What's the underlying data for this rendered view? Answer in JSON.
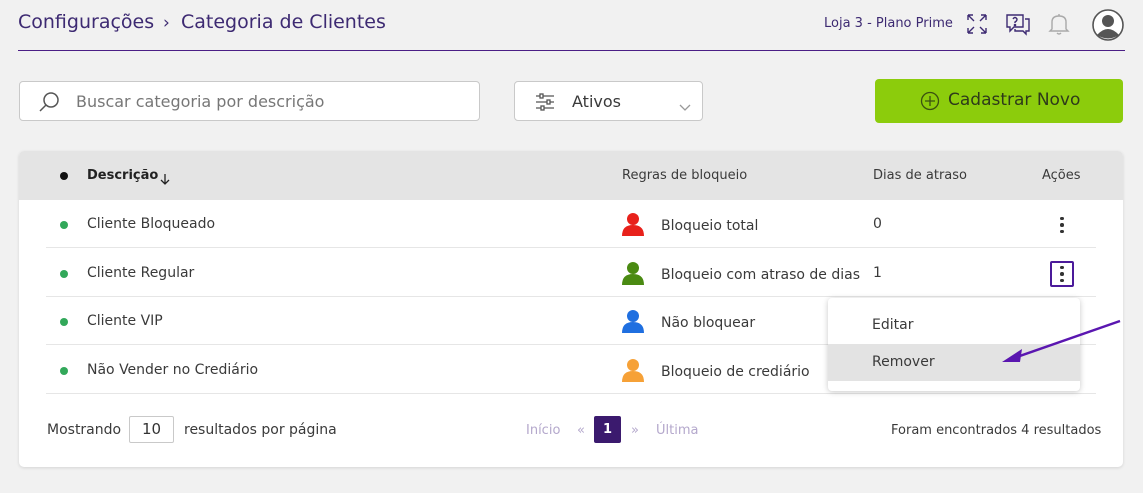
{
  "header": {
    "breadcrumb_root": "Configurações",
    "breadcrumb_sep": "›",
    "breadcrumb_current": "Categoria de Clientes",
    "store_plan": "Loja 3 - Plano Prime",
    "icons": [
      "fullscreen-icon",
      "help-chat-icon",
      "bell-icon",
      "user-avatar-icon"
    ]
  },
  "toolbar": {
    "search_placeholder": "Buscar categoria por descrição",
    "filter_value": "Ativos",
    "new_button": "Cadastrar Novo"
  },
  "table": {
    "columns": {
      "description": "Descrição",
      "rules": "Regras de bloqueio",
      "days": "Dias de atraso",
      "actions": "Ações"
    },
    "rows": [
      {
        "name": "Cliente Bloqueado",
        "rule": "Bloqueio total",
        "days": "0",
        "rule_color": "#e8211b"
      },
      {
        "name": "Cliente Regular",
        "rule": "Bloqueio com atraso de dias",
        "days": "1",
        "rule_color": "#4a8a12"
      },
      {
        "name": "Cliente VIP",
        "rule": "Não bloquear",
        "days": "",
        "rule_color": "#1f6fe0"
      },
      {
        "name": "Não Vender no Crediário",
        "rule": "Bloqueio de crediário",
        "days": "",
        "rule_color": "#f6a137"
      }
    ]
  },
  "footer": {
    "showing": "Mostrando",
    "per_page_value": "10",
    "per_page_suffix": "resultados por página",
    "first": "Início",
    "prev": "«",
    "current_page": "1",
    "next": "»",
    "last": "Última",
    "results": "Foram encontrados 4 resultados"
  },
  "action_menu": {
    "edit": "Editar",
    "remove": "Remover"
  },
  "colors": {
    "brand_purple": "#3d2a72",
    "accent_green": "#8ccc0c",
    "status_active": "#32a85a",
    "annotation_arrow": "#5a16b0"
  }
}
